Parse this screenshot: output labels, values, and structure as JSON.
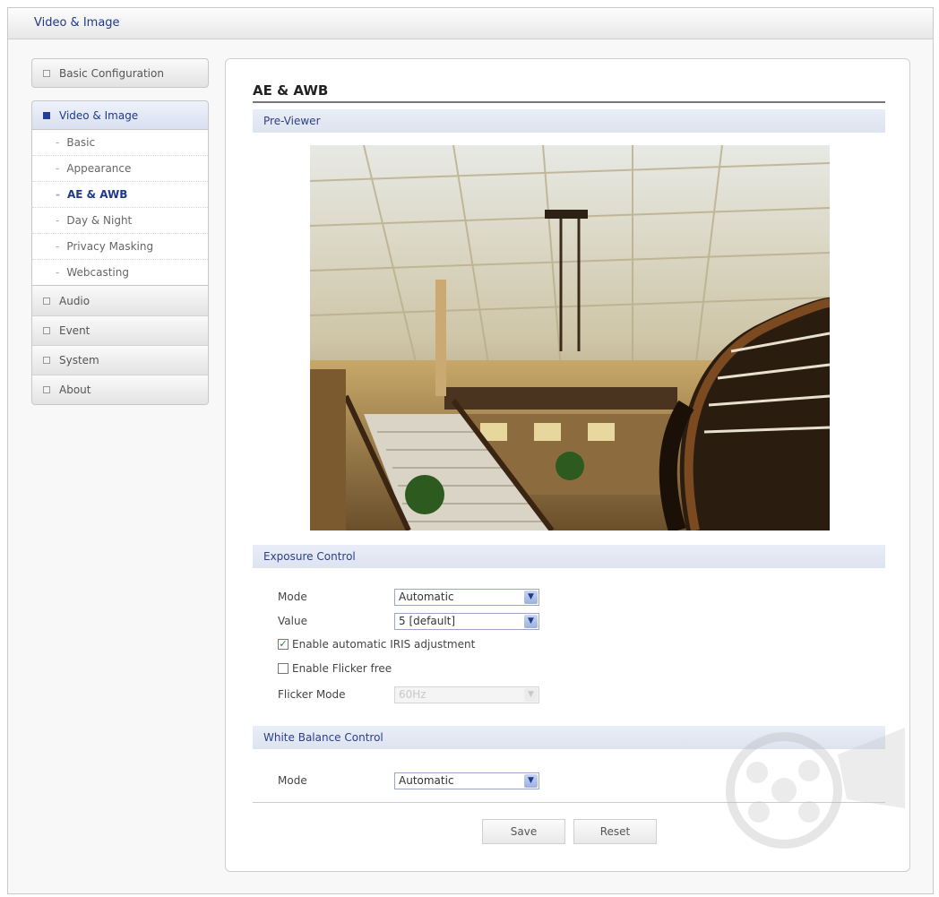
{
  "window": {
    "title": "Video & Image"
  },
  "sidebar": {
    "basic_config": "Basic Configuration",
    "video_image": {
      "label": "Video & Image",
      "items": [
        "Basic",
        "Appearance",
        "AE & AWB",
        "Day & Night",
        "Privacy Masking",
        "Webcasting"
      ],
      "selected": "AE & AWB"
    },
    "others": [
      "Audio",
      "Event",
      "System",
      "About"
    ]
  },
  "main": {
    "title": "AE & AWB",
    "preview_section": "Pre-Viewer",
    "exposure": {
      "section": "Exposure Control",
      "mode_label": "Mode",
      "mode_value": "Automatic",
      "value_label": "Value",
      "value_value": "5 [default]",
      "iris_label": "Enable automatic IRIS adjustment",
      "iris_checked": true,
      "flicker_label": "Enable Flicker free",
      "flicker_checked": false,
      "flicker_mode_label": "Flicker Mode",
      "flicker_mode_value": "60Hz"
    },
    "white_balance": {
      "section": "White Balance Control",
      "mode_label": "Mode",
      "mode_value": "Automatic"
    },
    "save_label": "Save",
    "reset_label": "Reset"
  },
  "colors": {
    "accent": "#1f3a8a",
    "section_bg": "#e3e8f3",
    "check": "#2a7a2a"
  }
}
